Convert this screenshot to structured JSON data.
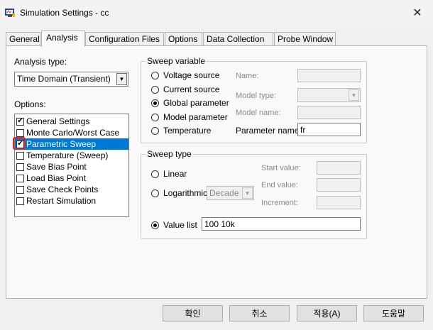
{
  "window": {
    "title": "Simulation Settings - cc",
    "app_icon": "pspice-app-icon",
    "close_icon": "close-icon",
    "close_glyph": "✕"
  },
  "tabs": [
    {
      "label": "General"
    },
    {
      "label": "Analysis"
    },
    {
      "label": "Configuration Files"
    },
    {
      "label": "Options"
    },
    {
      "label": "Data Collection"
    },
    {
      "label": "Probe Window"
    }
  ],
  "active_tab": "Analysis",
  "analysis": {
    "type_label": "Analysis type:",
    "type_value": "Time Domain (Transient)",
    "options_label": "Options:",
    "options": [
      {
        "label": "General Settings",
        "checked": true,
        "mark": "✔"
      },
      {
        "label": "Monte Carlo/Worst Case",
        "checked": false,
        "mark": ""
      },
      {
        "label": "Parametric Sweep",
        "checked": true,
        "mark": "✔",
        "selected": true
      },
      {
        "label": "Temperature (Sweep)",
        "checked": false,
        "mark": ""
      },
      {
        "label": "Save Bias Point",
        "checked": false,
        "mark": ""
      },
      {
        "label": "Load Bias Point",
        "checked": false,
        "mark": ""
      },
      {
        "label": "Save Check Points",
        "checked": false,
        "mark": ""
      },
      {
        "label": "Restart Simulation",
        "checked": false,
        "mark": ""
      }
    ]
  },
  "sweep_variable": {
    "legend": "Sweep variable",
    "radios": [
      {
        "label": "Voltage source",
        "checked": false
      },
      {
        "label": "Current source",
        "checked": false
      },
      {
        "label": "Global parameter",
        "checked": true
      },
      {
        "label": "Model parameter",
        "checked": false
      },
      {
        "label": "Temperature",
        "checked": false
      }
    ],
    "name_label": "Name:",
    "name_value": "",
    "model_type_label": "Model type:",
    "model_type_value": "",
    "model_name_label": "Model name:",
    "model_name_value": "",
    "parameter_name_label": "Parameter name:",
    "parameter_name_value": "fr"
  },
  "sweep_type": {
    "legend": "Sweep type",
    "linear_label": "Linear",
    "logarithmic_label": "Logarithmic",
    "log_scale_value": "Decade",
    "start_value_label": "Start value:",
    "start_value": "",
    "end_value_label": "End value:",
    "end_value": "",
    "increment_label": "Increment:",
    "increment": "",
    "value_list_label": "Value list",
    "value_list": "100 10k",
    "selected": "Value list"
  },
  "buttons": {
    "ok": "확인",
    "cancel": "취소",
    "apply": "적용(A)",
    "help": "도움말"
  }
}
